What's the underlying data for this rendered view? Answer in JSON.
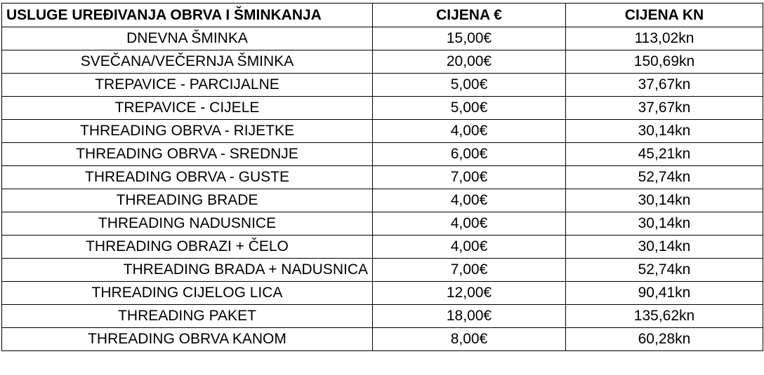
{
  "table": {
    "headers": {
      "service": "USLUGE UREĐIVANJA OBRVA I ŠMINKANJA",
      "price_eur": "CIJENA €",
      "price_kn": "CIJENA KN"
    },
    "rows": [
      {
        "service": "DNEVNA ŠMINKA",
        "price_eur": "15,00€",
        "price_kn": "113,02kn"
      },
      {
        "service": "SVEČANA/VEČERNJA ŠMINKA",
        "price_eur": "20,00€",
        "price_kn": "150,69kn"
      },
      {
        "service": "TREPAVICE - PARCIJALNE",
        "price_eur": "5,00€",
        "price_kn": "37,67kn"
      },
      {
        "service": "TREPAVICE - CIJELE",
        "price_eur": "5,00€",
        "price_kn": "37,67kn"
      },
      {
        "service": "THREADING OBRVA - RIJETKE",
        "price_eur": "4,00€",
        "price_kn": "30,14kn"
      },
      {
        "service": "THREADING OBRVA - SREDNJE",
        "price_eur": "6,00€",
        "price_kn": "45,21kn"
      },
      {
        "service": "THREADING OBRVA - GUSTE",
        "price_eur": "7,00€",
        "price_kn": "52,74kn"
      },
      {
        "service": "THREADING BRADE",
        "price_eur": "4,00€",
        "price_kn": "30,14kn"
      },
      {
        "service": "THREADING NADUSNICE",
        "price_eur": "4,00€",
        "price_kn": "30,14kn"
      },
      {
        "service": "THREADING OBRAZI + ČELO",
        "price_eur": "4,00€",
        "price_kn": "30,14kn"
      },
      {
        "service": "THREADING BRADA + NADUSNICA",
        "price_eur": "7,00€",
        "price_kn": "52,74kn"
      },
      {
        "service": "THREADING CIJELOG LICA",
        "price_eur": "12,00€",
        "price_kn": "90,41kn"
      },
      {
        "service": "THREADING PAKET",
        "price_eur": "18,00€",
        "price_kn": "135,62kn"
      },
      {
        "service": "THREADING OBRVA KANOM",
        "price_eur": "8,00€",
        "price_kn": "60,28kn"
      }
    ]
  }
}
